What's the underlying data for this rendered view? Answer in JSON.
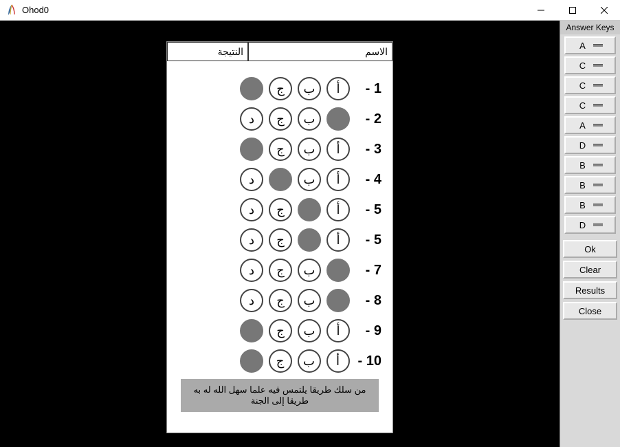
{
  "window": {
    "title": "Ohod0"
  },
  "sheet": {
    "header": {
      "name_label": "الاسم",
      "result_label": "النتيجة"
    },
    "options": [
      "أ",
      "ب",
      "ج",
      "د"
    ],
    "rows": [
      {
        "num": "1",
        "filled": [
          3
        ]
      },
      {
        "num": "2",
        "filled": [
          0
        ]
      },
      {
        "num": "3",
        "filled": [
          3
        ]
      },
      {
        "num": "4",
        "filled": [
          2
        ]
      },
      {
        "num": "5",
        "filled": [
          1
        ]
      },
      {
        "num": "5",
        "filled": [
          1
        ]
      },
      {
        "num": "7",
        "filled": [
          0
        ]
      },
      {
        "num": "8",
        "filled": [
          0
        ]
      },
      {
        "num": "9",
        "filled": [
          3
        ]
      },
      {
        "num": "10",
        "filled": [
          3
        ]
      }
    ],
    "quote": "من سلك طريقا يلتمس فيه علما سهل الله له به طريقا إلى الجنة"
  },
  "sidebar": {
    "title": "Answer Keys",
    "keys": [
      "A",
      "C",
      "C",
      "C",
      "A",
      "D",
      "B",
      "B",
      "B",
      "D"
    ],
    "actions": {
      "ok": "Ok",
      "clear": "Clear",
      "results": "Results",
      "close": "Close"
    }
  }
}
